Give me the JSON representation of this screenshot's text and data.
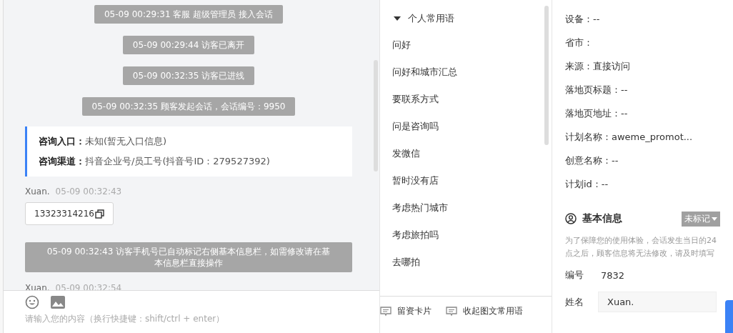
{
  "chat": {
    "messages": [
      {
        "kind": "system",
        "text": "05-09 00:29:31 客服 超级管理员 接入会话"
      },
      {
        "kind": "system",
        "text": "05-09 00:29:44 访客已离开"
      },
      {
        "kind": "system",
        "text": "05-09 00:32:35 访客已进线"
      },
      {
        "kind": "system",
        "text": "05-09 00:32:35 顾客发起会话，会话编号：9950"
      },
      {
        "kind": "info",
        "lines": [
          {
            "label": "咨询入口：",
            "value": "未知(暂无入口信息)"
          },
          {
            "label": "咨询渠道：",
            "value": "抖音企业号/员工号(抖音号ID：279527392)"
          }
        ]
      },
      {
        "kind": "visitor",
        "name": "Xuan.",
        "time": "05-09 00:32:43",
        "text": "13323314216"
      },
      {
        "kind": "system",
        "text": "05-09 00:32:43 访客手机号已自动标记右侧基本信息栏，如需修改请在基本信息栏直接操作"
      },
      {
        "kind": "header",
        "name": "Xuan.",
        "time": "05-09 00:32:54"
      }
    ],
    "input": {
      "placeholder": "请输入您的内容（换行快捷键：shift/ctrl + enter）"
    }
  },
  "phrases": {
    "group": {
      "label": "个人常用语",
      "expanded": true
    },
    "items": [
      "问好",
      "问好和城市汇总",
      "要联系方式",
      "问是咨询吗",
      "发微信",
      "暂时没有店",
      "考虑热门城市",
      "考虑旅拍吗",
      "去哪拍"
    ],
    "actions": [
      "留资卡片",
      "收起图文常用语"
    ]
  },
  "details": {
    "fields": [
      "设备：--",
      "省市：",
      "来源：直接访问",
      "落地页标题：--",
      "落地页地址：--",
      "计划名称：aweme_promot...",
      "创意名称：--",
      "计划id：--"
    ],
    "basic": {
      "title": "基本信息",
      "tag": "未标记",
      "note": "为了保障您的使用体验，会话发生当日的24点之后，顾客信息将无法修改，请及时填写",
      "number_label": "编号",
      "number": "7832",
      "name_label": "姓名",
      "name_value": "Xuan."
    }
  }
}
